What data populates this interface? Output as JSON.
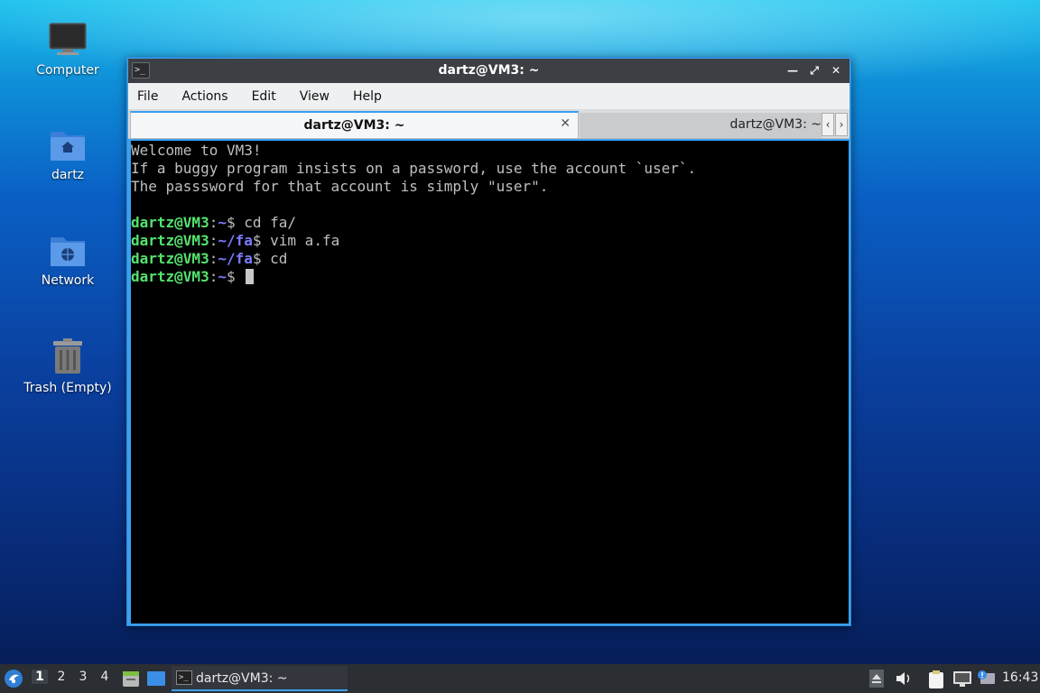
{
  "desktop": {
    "icons": [
      {
        "label": "Computer",
        "icon": "computer-icon"
      },
      {
        "label": "dartz",
        "icon": "home-folder-icon"
      },
      {
        "label": "Network",
        "icon": "network-folder-icon"
      },
      {
        "label": "Trash (Empty)",
        "icon": "trash-icon"
      }
    ]
  },
  "window": {
    "title": "dartz@VM3: ~",
    "controls": [
      "minimize",
      "maximize",
      "close"
    ],
    "menu": [
      "File",
      "Actions",
      "Edit",
      "View",
      "Help"
    ],
    "tabs": [
      {
        "label": "dartz@VM3: ~",
        "active": true
      },
      {
        "label": "dartz@VM3: ~",
        "active": false
      }
    ]
  },
  "terminal": {
    "welcome": [
      "Welcome to VM3!",
      "If a buggy program insists on a password, use the account `user`.",
      "The passsword for that account is simply \"user\"."
    ],
    "prompt_user": "dartz@VM3",
    "prompt_colon": ":",
    "prompt_dollar": "$",
    "commands": [
      {
        "path": "~",
        "command": " cd fa/"
      },
      {
        "path": "~/fa",
        "command": " vim a.fa"
      },
      {
        "path": "~/fa",
        "command": " cd"
      },
      {
        "path": "~",
        "command": " "
      }
    ]
  },
  "taskbar": {
    "workspaces": [
      "1",
      "2",
      "3",
      "4"
    ],
    "active_workspace": "1",
    "task_label": "dartz@VM3: ~",
    "clock": "16:43",
    "accent": "#3aa0f0"
  }
}
